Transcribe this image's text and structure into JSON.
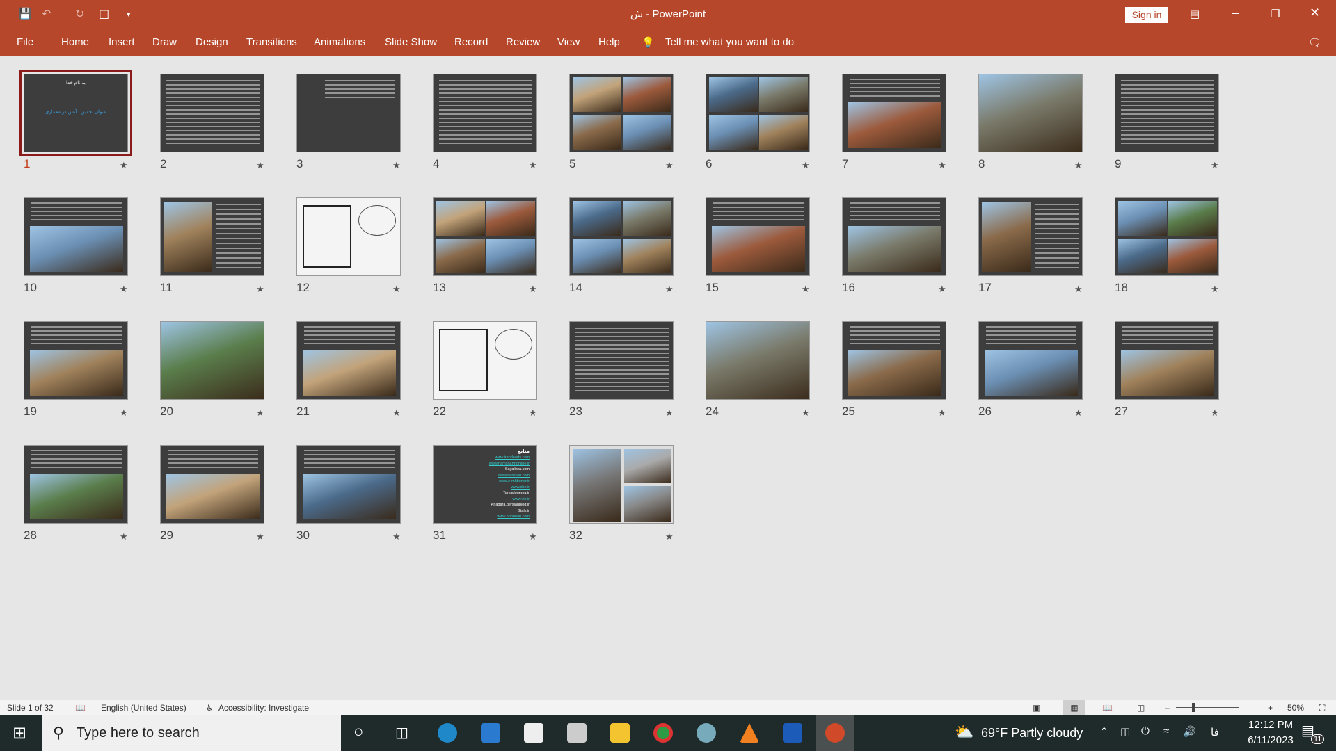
{
  "app": {
    "title": "ش  -  PowerPoint",
    "sign_in": "Sign in"
  },
  "menu": [
    "File",
    "Home",
    "Insert",
    "Draw",
    "Design",
    "Transitions",
    "Animations",
    "Slide Show",
    "Record",
    "Review",
    "View",
    "Help"
  ],
  "tell_me": "Tell me what you want to do",
  "slide1": {
    "line1": "به نام خدا",
    "line2": "عنوان تحقیق : آتش در معماری"
  },
  "slide31": {
    "heading": "منابع",
    "sources": [
      "www.irandearts.com",
      "www.hamshahrionline.ir",
      "Sayaliiwa.com",
      "www.beresad.com",
      "www.e-mhboner.ir",
      "www.chn.ir",
      "Tamadonema.ir",
      "www.vic.ir",
      "Ariagara.persianblog.ir",
      "Gtalk.ir",
      "www.noonoab.com"
    ]
  },
  "slides": [
    {
      "n": "1",
      "kind": "title"
    },
    {
      "n": "2",
      "kind": "text"
    },
    {
      "n": "3",
      "kind": "short"
    },
    {
      "n": "4",
      "kind": "text"
    },
    {
      "n": "5",
      "kind": "collage"
    },
    {
      "n": "6",
      "kind": "collage"
    },
    {
      "n": "7",
      "kind": "textphoto"
    },
    {
      "n": "8",
      "kind": "photo"
    },
    {
      "n": "9",
      "kind": "text"
    },
    {
      "n": "10",
      "kind": "textphoto"
    },
    {
      "n": "11",
      "kind": "photoleft"
    },
    {
      "n": "12",
      "kind": "plan"
    },
    {
      "n": "13",
      "kind": "collage"
    },
    {
      "n": "14",
      "kind": "collage"
    },
    {
      "n": "15",
      "kind": "textphoto"
    },
    {
      "n": "16",
      "kind": "textphoto"
    },
    {
      "n": "17",
      "kind": "photoleft"
    },
    {
      "n": "18",
      "kind": "collage"
    },
    {
      "n": "19",
      "kind": "textphoto"
    },
    {
      "n": "20",
      "kind": "photo"
    },
    {
      "n": "21",
      "kind": "textphoto"
    },
    {
      "n": "22",
      "kind": "plan"
    },
    {
      "n": "23",
      "kind": "text"
    },
    {
      "n": "24",
      "kind": "photo"
    },
    {
      "n": "25",
      "kind": "textphoto"
    },
    {
      "n": "26",
      "kind": "textphoto"
    },
    {
      "n": "27",
      "kind": "textphoto"
    },
    {
      "n": "28",
      "kind": "textphoto"
    },
    {
      "n": "29",
      "kind": "textphoto"
    },
    {
      "n": "30",
      "kind": "textphoto"
    },
    {
      "n": "31",
      "kind": "sources"
    },
    {
      "n": "32",
      "kind": "bw"
    }
  ],
  "selected_slide": "1",
  "status": {
    "slide": "Slide 1 of 32",
    "language": "English (United States)",
    "accessibility": "Accessibility: Investigate",
    "zoom": "50%",
    "zoom_percent": 50
  },
  "taskbar": {
    "search_placeholder": "Type here to search",
    "weather": "69°F  Partly cloudy",
    "time": "12:12 PM",
    "date": "6/11/2023",
    "lang": "فا",
    "notifications": "11"
  },
  "colors": {
    "brand": "#b7472a",
    "selection": "#8b1a1a"
  }
}
